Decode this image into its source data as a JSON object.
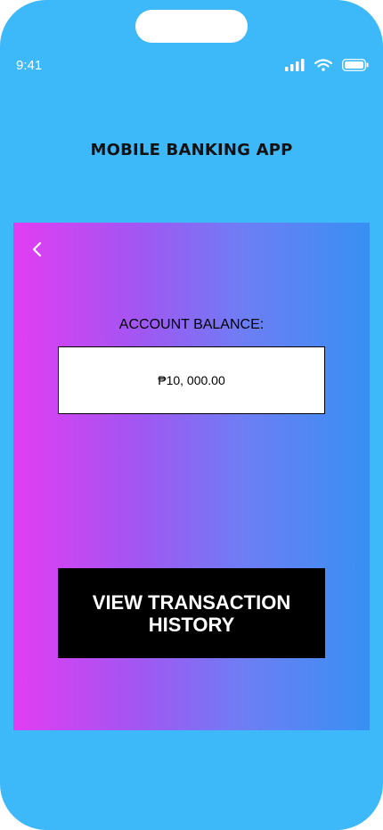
{
  "status_bar": {
    "time": "9:41",
    "icons": [
      "signal-icon",
      "wifi-icon",
      "battery-icon"
    ]
  },
  "app": {
    "title": "MOBILE BANKING APP"
  },
  "account": {
    "back_icon": "chevron-left-icon",
    "balance_label": "ACCOUNT BALANCE:",
    "balance_value": "₱10, 000.00",
    "history_button_label": "VIEW TRANSACTION HISTORY"
  },
  "colors": {
    "phone_background": "#3db8f8",
    "gradient_start": "#e23df2",
    "gradient_end": "#3790f3",
    "button_background": "#000000",
    "button_text": "#ffffff"
  }
}
